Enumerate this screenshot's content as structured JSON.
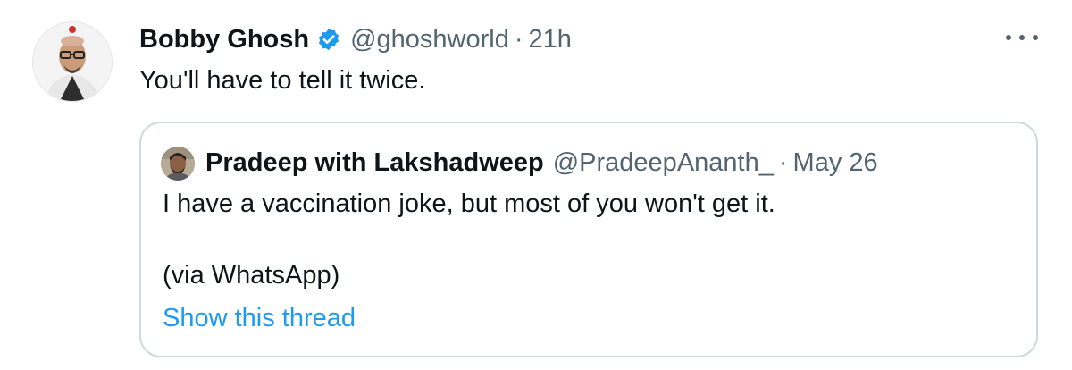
{
  "tweet": {
    "author_name": "Bobby Ghosh",
    "handle": "@ghoshworld",
    "separator": "·",
    "time": "21h",
    "text": "You'll have to tell it twice.",
    "verified_icon": "verified-badge-icon",
    "more_icon": "more-options-icon",
    "accent_color": "#1d9bf0"
  },
  "quoted": {
    "author_name": "Pradeep with Lakshadweep",
    "handle": "@PradeepAnanth_",
    "separator": "·",
    "time": "May 26",
    "line1": "I have a vaccination joke, but most of you won't get it.",
    "line2": "(via WhatsApp)",
    "show_thread": "Show this thread"
  }
}
